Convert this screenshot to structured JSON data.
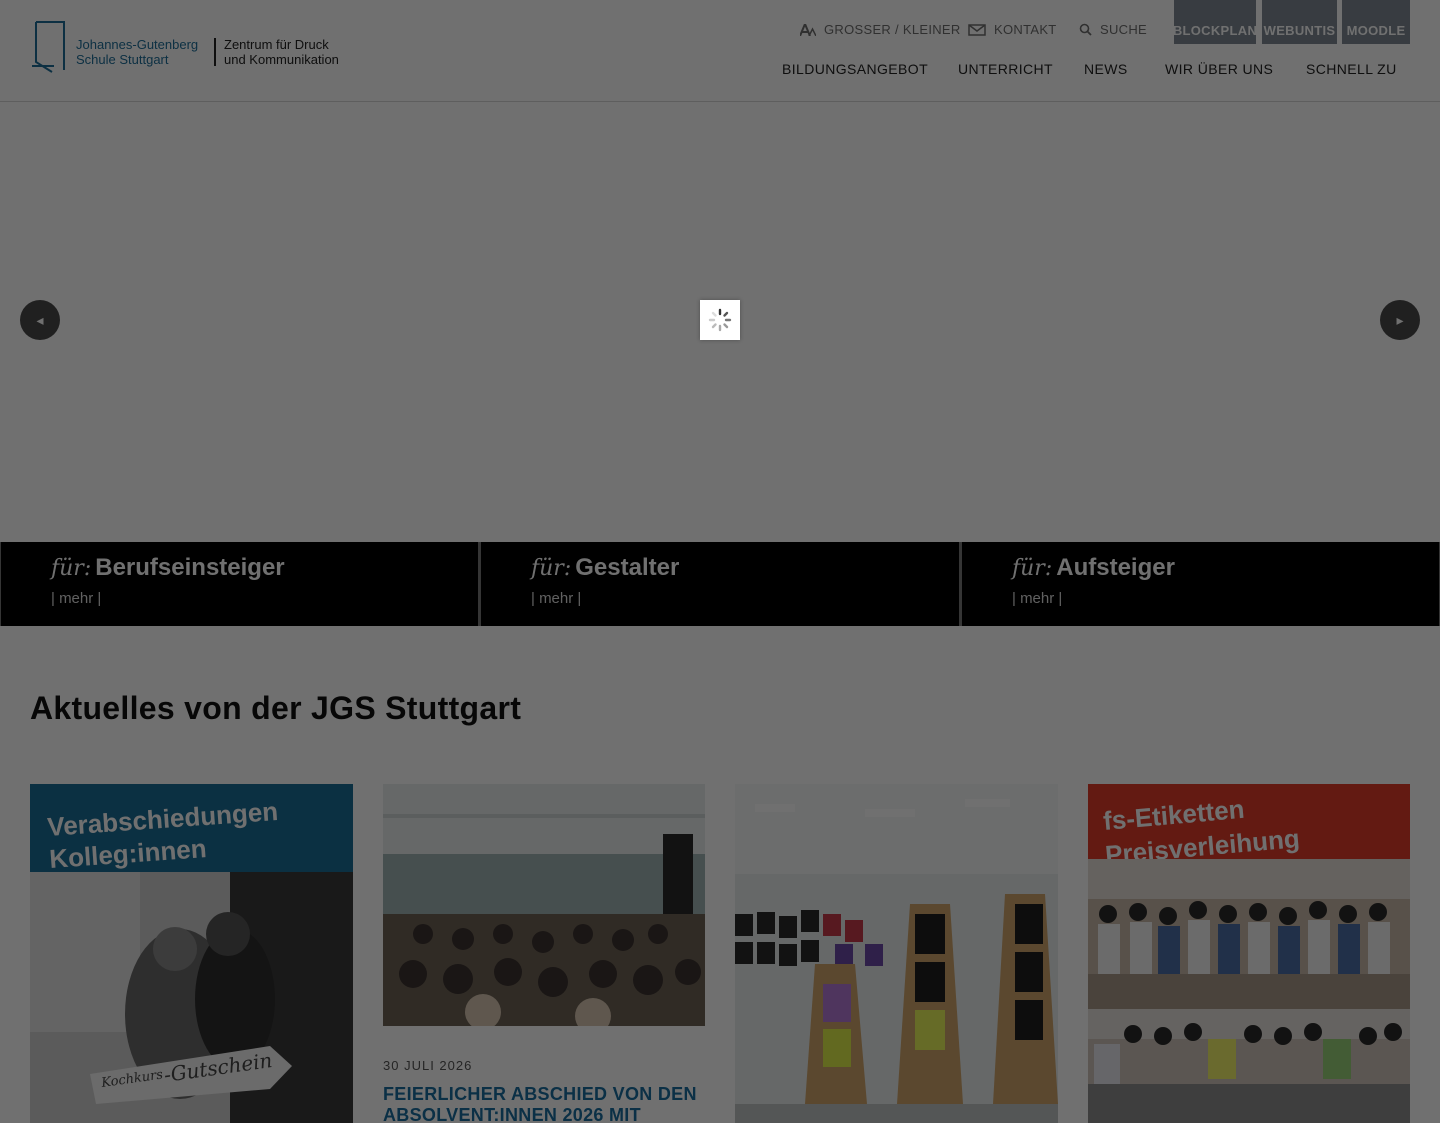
{
  "logo": {
    "line1": "Johannes-Gutenberg",
    "line2": "Schule Stuttgart",
    "line3": "Zentrum für Druck",
    "line4": "und Kommunikation"
  },
  "utility": {
    "font_size": "GROSSER / KLEINER",
    "contact": "KONTAKT",
    "search": "SUCHE"
  },
  "tiles": [
    "BLOCKPLAN",
    "WEBUNTIS",
    "MOODLE"
  ],
  "nav": [
    "BILDUNGSANGEBOT",
    "UNTERRICHT",
    "NEWS",
    "WIR ÜBER UNS",
    "SCHNELL ZU"
  ],
  "slider": {
    "prev_icon": "chevron-left-icon",
    "next_icon": "chevron-right-icon",
    "loading_icon": "spinner-icon"
  },
  "targets": [
    {
      "prefix": "für:",
      "name": "Berufseinsteiger",
      "more": "| mehr |"
    },
    {
      "prefix": "für:",
      "name": "Gestalter",
      "more": "| mehr |"
    },
    {
      "prefix": "für:",
      "name": "Aufsteiger",
      "more": "| mehr |"
    }
  ],
  "news": {
    "title": "Aktuelles von der JGS Stuttgart",
    "cards": [
      {
        "image_text_1": "Verabschiedungen",
        "image_text_2": "Kolleg:innen",
        "image_text_3": "Kochkurs",
        "image_text_4": "-Gutschein"
      },
      {
        "date": "30 JULI 2026",
        "headline": "FEIERLICHER ABSCHIED VON DEN ABSOLVENT:INNEN 2026 MIT"
      },
      {},
      {
        "image_text_1": "fs-Etiketten",
        "image_text_2": "Preisverleihung"
      }
    ]
  },
  "colors": {
    "brand_blue": "#1f6f9a",
    "tile_gray": "#7f8a94",
    "overlay": "rgba(0,0,0,0.56)"
  }
}
